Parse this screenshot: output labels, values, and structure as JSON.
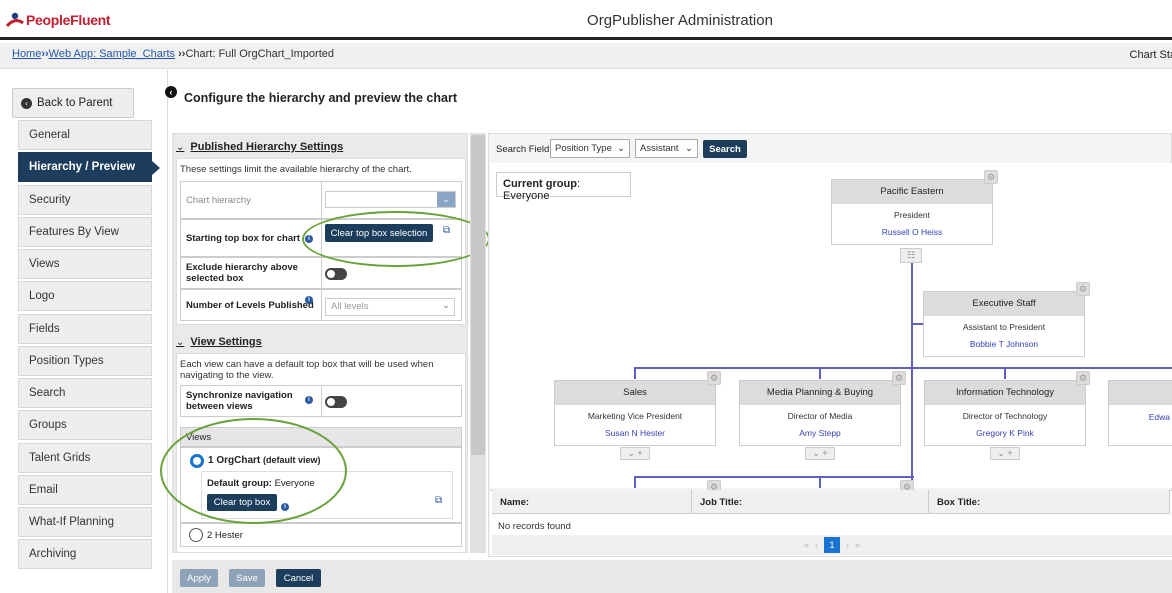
{
  "header": {
    "logo_text": "PeopleFluent",
    "app_title": "OrgPublisher Administration"
  },
  "breadcrumb": {
    "home": "Home",
    "sep": "››",
    "webapp": "Web App: Sample_Charts",
    "current": "Chart: Full OrgChart_Imported",
    "chart_status": "Chart Sta"
  },
  "leftnav": {
    "back": "Back to Parent",
    "items": [
      "General",
      "Hierarchy / Preview",
      "Security",
      "Features By View",
      "Views",
      "Logo",
      "Fields",
      "Position Types",
      "Search",
      "Groups",
      "Talent Grids",
      "Email",
      "What-If Planning",
      "Archiving"
    ],
    "active_index": 1
  },
  "page_title": "Configure the hierarchy and preview the chart",
  "published": {
    "heading": "Published Hierarchy Settings",
    "description": "These settings limit the available hierarchy of the chart.",
    "chart_hierarchy_label": "Chart hierarchy",
    "starting_box_label": "Starting top box for chart",
    "clear_top_box": "Clear top box selection",
    "exclude_label": "Exclude hierarchy above selected box",
    "levels_label": "Number of Levels Published",
    "levels_value": "All levels"
  },
  "view_settings": {
    "heading": "View Settings",
    "description": "Each view can have a default top box that will be used when navigating to the view.",
    "sync_label": "Synchronize navigation between views",
    "views_header": "Views",
    "view1_name": "1 OrgChart",
    "view1_suffix": "(default view)",
    "default_group_label": "Default group:",
    "default_group_value": "Everyone",
    "clear_top_box": "Clear top box",
    "view2_name": "2 Hester"
  },
  "search": {
    "label": "Search Field:",
    "field": "Position Type",
    "value": "Assistant",
    "button": "Search"
  },
  "current_group": {
    "label": "Current group",
    "value": "Everyone"
  },
  "cards": [
    {
      "title": "Pacific Eastern",
      "job": "President",
      "person": "Russell O Heiss"
    },
    {
      "title": "Executive Staff",
      "job": "Assistant to President",
      "person": "Bobbie T Johnson"
    },
    {
      "title": "Sales",
      "job": "Marketing Vice President",
      "person": "Susan N Hester"
    },
    {
      "title": "Media Planning & Buying",
      "job": "Director of Media",
      "person": "Amy Stepp"
    },
    {
      "title": "Information Technology",
      "job": "Director of Technology",
      "person": "Gregory K Pink"
    },
    {
      "title": "",
      "job": "",
      "person": "Edwa"
    }
  ],
  "grid": {
    "col_name": "Name:",
    "col_job": "Job Title:",
    "col_box": "Box Title:",
    "empty": "No records found",
    "page": "1"
  },
  "footer": {
    "apply": "Apply",
    "save": "Save",
    "cancel": "Cancel"
  },
  "colors": {
    "nav_active": "#1d3d5c",
    "highlight_oval": "#6aa23a",
    "connector": "#6060c0",
    "link": "#2255aa"
  }
}
